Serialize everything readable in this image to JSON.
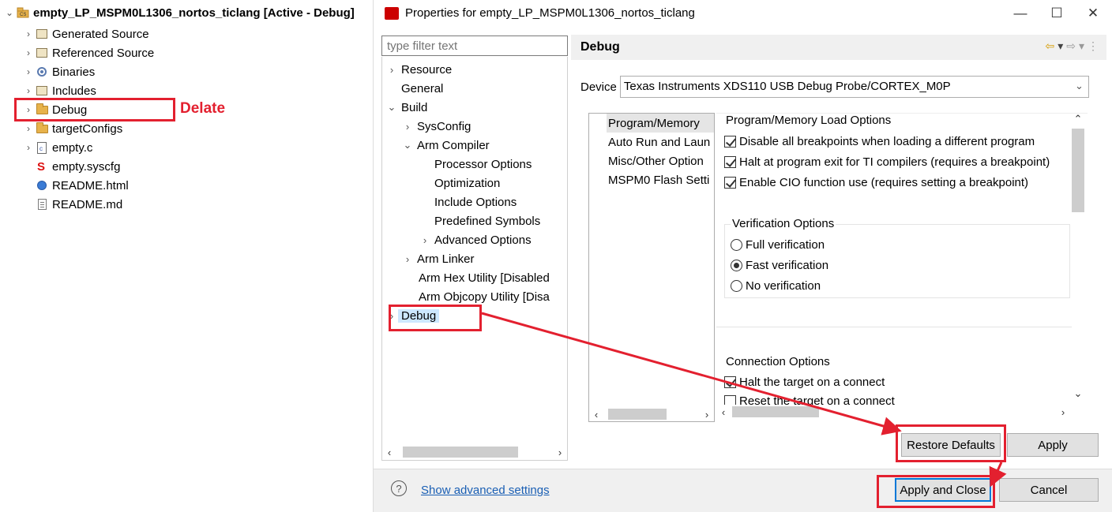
{
  "explorer": {
    "project_title": "empty_LP_MSPM0L1306_nortos_ticlang  [Active - Debug]",
    "items": [
      {
        "label": "Generated Source",
        "icon": "source-folder-icon",
        "twisty": "›"
      },
      {
        "label": "Referenced Source",
        "icon": "source-folder-icon",
        "twisty": "›"
      },
      {
        "label": "Binaries",
        "icon": "binaries-icon",
        "twisty": "›"
      },
      {
        "label": "Includes",
        "icon": "includes-icon",
        "twisty": "›"
      },
      {
        "label": "Debug",
        "icon": "folder-icon",
        "twisty": "›"
      },
      {
        "label": "targetConfigs",
        "icon": "folder-icon",
        "twisty": "›"
      },
      {
        "label": "empty.c",
        "icon": "c-file-icon",
        "twisty": "›"
      },
      {
        "label": "empty.syscfg",
        "icon": "syscfg-file-icon",
        "twisty": ""
      },
      {
        "label": "README.html",
        "icon": "html-file-icon",
        "twisty": ""
      },
      {
        "label": "README.md",
        "icon": "md-file-icon",
        "twisty": ""
      }
    ],
    "annotation": "Delate"
  },
  "dialog": {
    "title": "Properties for empty_LP_MSPM0L1306_nortos_ticlang",
    "window_controls": {
      "minimize": "—",
      "maximize": "☐",
      "close": "✕"
    },
    "filter_placeholder": "type filter text",
    "tree": [
      {
        "label": "Resource",
        "twisty": "›"
      },
      {
        "label": "General",
        "twisty": ""
      },
      {
        "label": "Build",
        "twisty": "⌄"
      },
      {
        "label": "SysConfig",
        "twisty": "›"
      },
      {
        "label": "Arm Compiler",
        "twisty": "⌄"
      },
      {
        "label": "Processor Options",
        "twisty": ""
      },
      {
        "label": "Optimization",
        "twisty": ""
      },
      {
        "label": "Include Options",
        "twisty": ""
      },
      {
        "label": "Predefined Symbols",
        "twisty": ""
      },
      {
        "label": "Advanced Options",
        "twisty": "›"
      },
      {
        "label": "Arm Linker",
        "twisty": "›"
      },
      {
        "label": "Arm Hex Utility  [Disabled",
        "twisty": ""
      },
      {
        "label": "Arm Objcopy Utility  [Disa",
        "twisty": ""
      },
      {
        "label": "Debug",
        "twisty": "›"
      }
    ],
    "page_title": "Debug",
    "device_label": "Device",
    "device_value": "Texas Instruments XDS110 USB Debug Probe/CORTEX_M0P",
    "categories": [
      "Program/Memory",
      "Auto Run and Laun",
      "Misc/Other Option",
      "MSPM0 Flash Setti"
    ],
    "load_group": {
      "title": "Program/Memory Load Options",
      "options": [
        {
          "label": "Disable all breakpoints when loading a different program",
          "checked": true
        },
        {
          "label": "Halt at program exit for TI compilers (requires a breakpoint)",
          "checked": true
        },
        {
          "label": "Enable CIO function use (requires setting a breakpoint)",
          "checked": true
        }
      ]
    },
    "verification_group": {
      "title": "Verification Options",
      "options": [
        {
          "label": "Full verification",
          "selected": false
        },
        {
          "label": "Fast verification",
          "selected": true
        },
        {
          "label": "No verification",
          "selected": false
        }
      ]
    },
    "connection_group": {
      "title": "Connection Options",
      "options": [
        {
          "label": "Halt the target on a connect",
          "checked": true
        },
        {
          "label": "Reset the target on a connect",
          "checked": false
        }
      ]
    },
    "buttons": {
      "restore_defaults": "Restore Defaults",
      "apply": "Apply",
      "apply_and_close": "Apply and Close",
      "cancel": "Cancel"
    },
    "advanced_link": "Show advanced settings",
    "help_glyph": "?"
  },
  "colors": {
    "annotation_red": "#e3202f",
    "selection_blue": "#cde8ff",
    "link_blue": "#1a5fb4",
    "primary_button_border": "#0078d7"
  }
}
